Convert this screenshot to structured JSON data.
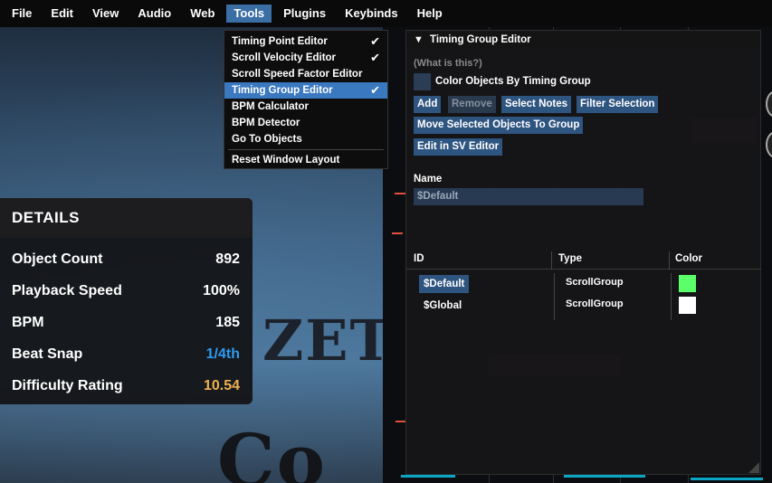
{
  "menubar": {
    "items": [
      {
        "label": "File"
      },
      {
        "label": "Edit"
      },
      {
        "label": "View"
      },
      {
        "label": "Audio"
      },
      {
        "label": "Web"
      },
      {
        "label": "Tools"
      },
      {
        "label": "Plugins"
      },
      {
        "label": "Keybinds"
      },
      {
        "label": "Help"
      }
    ],
    "active_label": "Tools"
  },
  "tools_menu": {
    "items": [
      {
        "label": "Timing Point Editor",
        "checked": true
      },
      {
        "label": "Scroll Velocity Editor",
        "checked": true
      },
      {
        "label": "Scroll Speed Factor Editor",
        "checked": false
      },
      {
        "label": "Timing Group Editor",
        "checked": true,
        "highlighted": true
      },
      {
        "label": "BPM Calculator",
        "checked": false
      },
      {
        "label": "BPM Detector",
        "checked": false
      },
      {
        "label": "Go To Objects",
        "checked": false
      },
      {
        "label": "Reset Window Layout",
        "checked": false
      }
    ],
    "check_glyph": "✔"
  },
  "details": {
    "title": "DETAILS",
    "rows": [
      {
        "label": "Object Count",
        "value": "892"
      },
      {
        "label": "Playback Speed",
        "value": "100%"
      },
      {
        "label": "BPM",
        "value": "185"
      },
      {
        "label": "Beat Snap",
        "value": "1/4th"
      },
      {
        "label": "Difficulty Rating",
        "value": "10.54"
      }
    ],
    "colors": {
      "beat_snap": "#2d9bf0",
      "difficulty": "#f0b050"
    }
  },
  "timing_group_editor": {
    "title": "Timing Group Editor",
    "collapse_icon": "▼",
    "help_link": "(What is this?)",
    "color_objects_label": "Color Objects By Timing Group",
    "buttons": {
      "add": "Add",
      "remove": "Remove",
      "select_notes": "Select Notes",
      "filter_selection": "Filter Selection",
      "move_selected": "Move Selected Objects To Group",
      "edit_sv": "Edit in SV Editor"
    },
    "name_label": "Name",
    "name_value": "$Default",
    "table": {
      "headers": {
        "id": "ID",
        "type": "Type",
        "color": "Color"
      },
      "rows": [
        {
          "id": "$Default",
          "type": "ScrollGroup",
          "color": "#5aff6a",
          "selected": true
        },
        {
          "id": "$Global",
          "type": "ScrollGroup",
          "color": "#ffffff",
          "selected": false
        }
      ]
    }
  },
  "background": {
    "text_1": "ZETO",
    "text_2": "Co"
  }
}
